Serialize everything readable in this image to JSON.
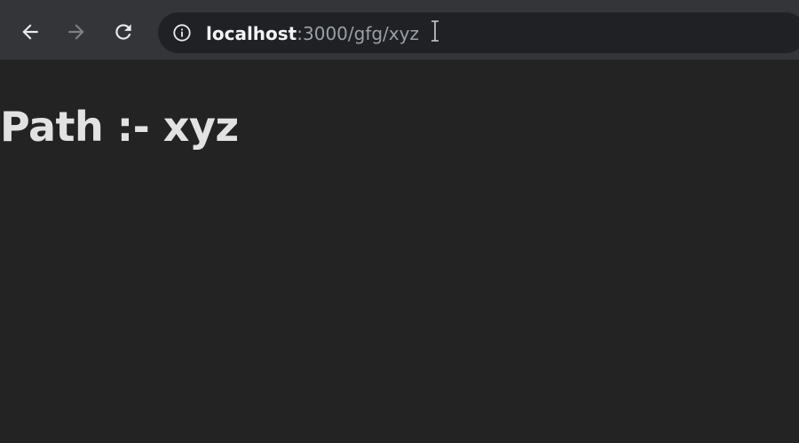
{
  "browser": {
    "url_host": "localhost",
    "url_path": ":3000/gfg/xyz",
    "icons": {
      "back": "back-arrow-icon",
      "forward": "forward-arrow-icon",
      "reload": "reload-icon",
      "site_info": "info-icon",
      "cursor": "text-cursor-icon"
    },
    "colors": {
      "toolbar": "#333538",
      "omnibox": "#202124",
      "page_background": "#232323"
    }
  },
  "page": {
    "heading": "Path :- xyz"
  }
}
